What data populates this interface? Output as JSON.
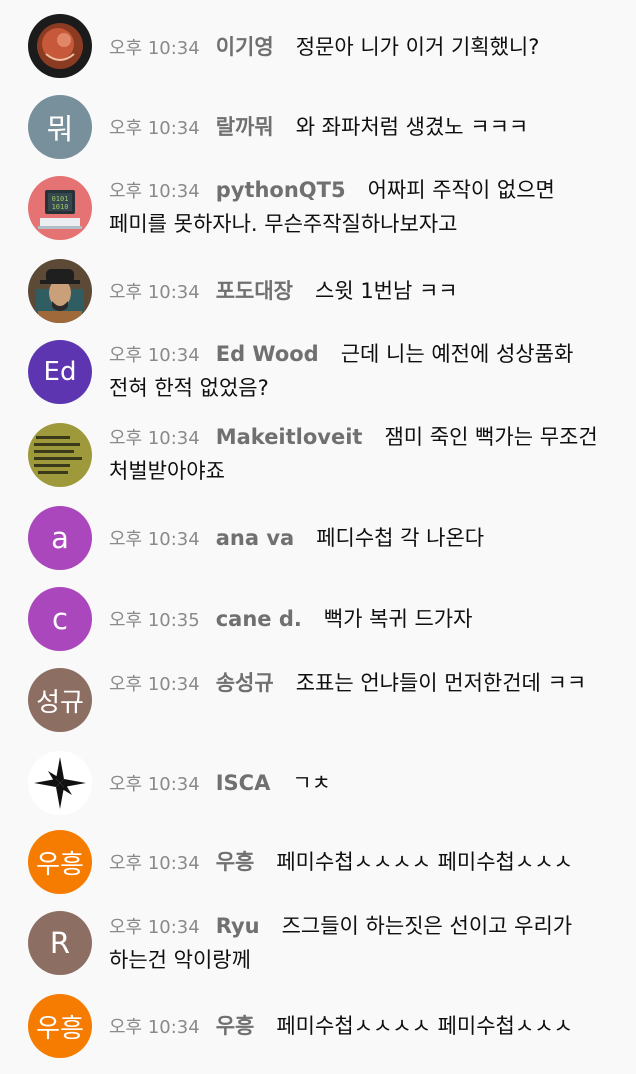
{
  "messages": [
    {
      "time": "오후 10:34",
      "author": "이기영",
      "text": "정문아 니가 이거 기획했니?",
      "avatar": {
        "kind": "image",
        "icon": "photo-icon"
      }
    },
    {
      "time": "오후 10:34",
      "author": "랄까뭐",
      "text": "와 좌파처럼 생겼노 ㅋㅋㅋ",
      "avatar": {
        "kind": "letter",
        "letter": "뭐",
        "color": "#78909c"
      }
    },
    {
      "time": "오후 10:34",
      "author": "pythonQT5",
      "text": "어짜피 주작이 없으면 페미를 못하자나. 무슨주작질하나보자고",
      "avatar": {
        "kind": "image",
        "icon": "computer-icon"
      }
    },
    {
      "time": "오후 10:34",
      "author": "포도대장",
      "text": "스윗 1번남 ㅋㅋ",
      "avatar": {
        "kind": "image",
        "icon": "portrait-icon"
      }
    },
    {
      "time": "오후 10:34",
      "author": "Ed Wood",
      "text": "근데 니는 예전에 성상품화 전혀 한적 없었음?",
      "avatar": {
        "kind": "letter",
        "letter": "Ed",
        "color": "#5e35b1"
      }
    },
    {
      "time": "오후 10:34",
      "author": "Makeitloveit",
      "text": "잼미 죽인 뻑가는 무조건 처벌받아야죠",
      "avatar": {
        "kind": "image",
        "icon": "text-image-icon"
      }
    },
    {
      "time": "오후 10:34",
      "author": "ana va",
      "text": "페디수첩 각 나온다",
      "avatar": {
        "kind": "letter",
        "letter": "a",
        "color": "#ab47bc"
      }
    },
    {
      "time": "오후 10:35",
      "author": "cane d.",
      "text": "뻑가 복귀 드가자",
      "avatar": {
        "kind": "letter",
        "letter": "c",
        "color": "#ab47bc"
      }
    },
    {
      "time": "오후 10:34",
      "author": "송성규",
      "text": "조표는 언냐들이 먼저한건데 ㅋㅋ",
      "avatar": {
        "kind": "letter",
        "letter": "성규",
        "color": "#8d6e63"
      }
    },
    {
      "time": "오후 10:34",
      "author": "ISCA",
      "text": "ㄱㅊ",
      "avatar": {
        "kind": "image",
        "icon": "logo-icon"
      }
    },
    {
      "time": "오후 10:34",
      "author": "우흥",
      "text": "페미수첩ㅅㅅㅅㅅ 페미수첩ㅅㅅㅅ",
      "avatar": {
        "kind": "letter",
        "letter": "우흥",
        "color": "#f57c00"
      }
    },
    {
      "time": "오후 10:34",
      "author": "Ryu",
      "text": "즈그들이 하는짓은 선이고 우리가 하는건 악이랑께",
      "avatar": {
        "kind": "letter",
        "letter": "R",
        "color": "#8d6e63"
      }
    },
    {
      "time": "오후 10:34",
      "author": "우흥",
      "text": "페미수첩ㅅㅅㅅㅅ 페미수첩ㅅㅅㅅ",
      "avatar": {
        "kind": "letter",
        "letter": "우흥",
        "color": "#f57c00"
      }
    }
  ]
}
